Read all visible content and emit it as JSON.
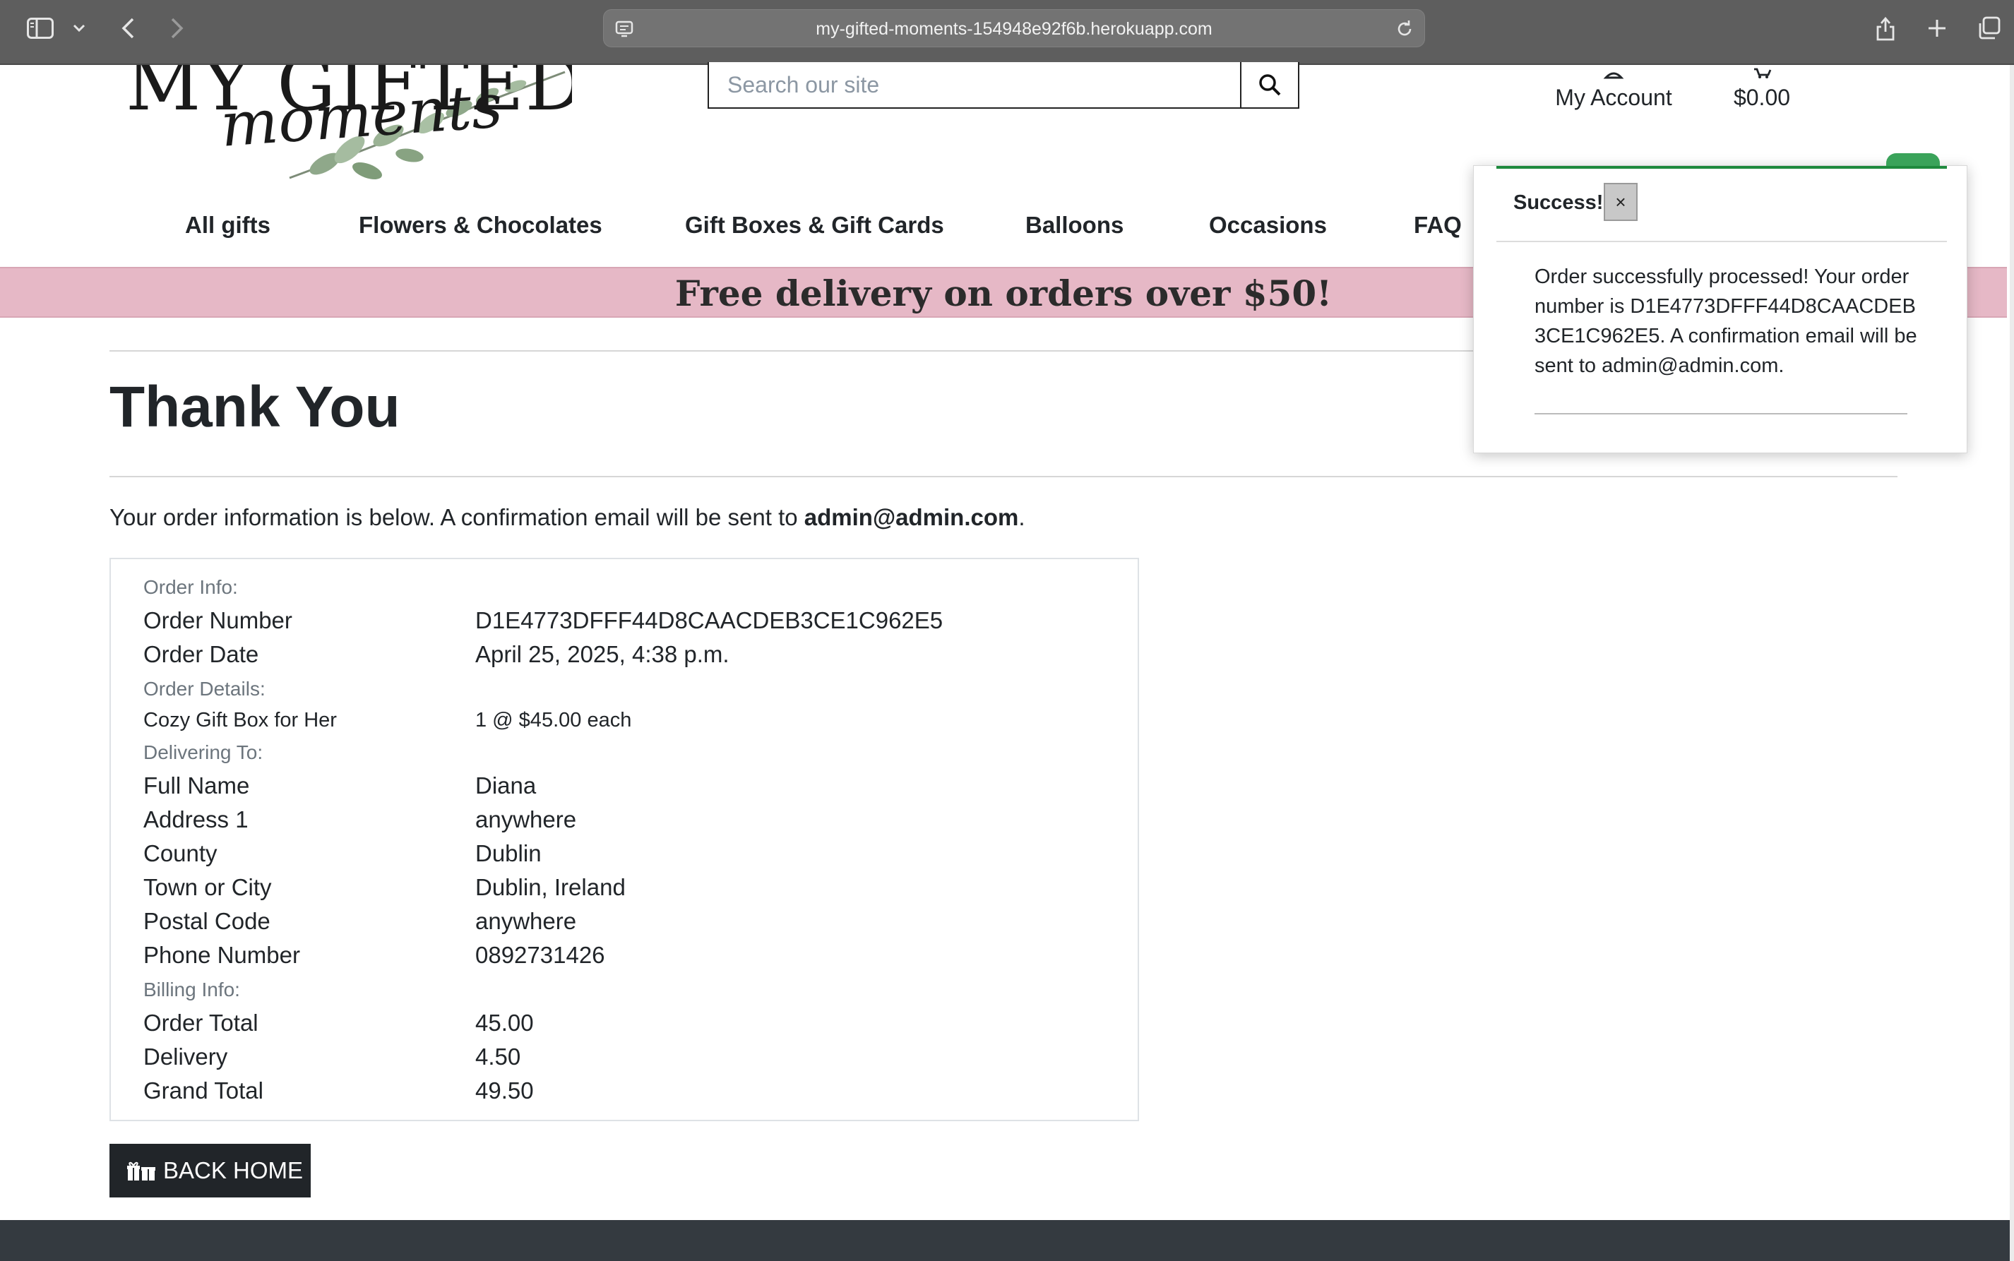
{
  "browser": {
    "url": "my-gifted-moments-154948e92f6b.herokuapp.com"
  },
  "header": {
    "logo_line1": "MY GIFTED",
    "logo_line2": "moments",
    "search_placeholder": "Search our site",
    "account_label": "My Account",
    "cart_total": "$0.00"
  },
  "nav": {
    "items": [
      "All gifts",
      "Flowers & Chocolates",
      "Gift Boxes & Gift Cards",
      "Balloons",
      "Occasions",
      "FAQ"
    ]
  },
  "banner": {
    "text": "Free delivery on orders over $50!"
  },
  "page": {
    "title": "Thank You",
    "intro_prefix": "Your order information is below. A confirmation email will be sent to ",
    "intro_email": "admin@admin.com",
    "intro_suffix": "."
  },
  "order": {
    "order_info_label": "Order Info:",
    "order_number_label": "Order Number",
    "order_number": "D1E4773DFFF44D8CAACDEB3CE1C962E5",
    "order_date_label": "Order Date",
    "order_date": "April 25, 2025, 4:38 p.m.",
    "order_details_label": "Order Details:",
    "item_name": "Cozy Gift Box for Her",
    "item_qty_price": "1 @ $45.00 each",
    "delivering_label": "Delivering To:",
    "full_name_label": "Full Name",
    "full_name": "Diana",
    "address1_label": "Address 1",
    "address1": "anywhere",
    "county_label": "County",
    "county": "Dublin",
    "town_label": "Town or City",
    "town": "Dublin, Ireland",
    "postal_label": "Postal Code",
    "postal": "anywhere",
    "phone_label": "Phone Number",
    "phone": "0892731426",
    "billing_label": "Billing Info:",
    "order_total_label": "Order Total",
    "order_total": "45.00",
    "delivery_label": "Delivery",
    "delivery": "4.50",
    "grand_total_label": "Grand Total",
    "grand_total": "49.50"
  },
  "actions": {
    "back_home": "BACK HOME"
  },
  "toast": {
    "header": "Success!",
    "close": "×",
    "message": "Order successfully processed! Your order number is D1E4773DFFF44D8CAACDEB3CE1C962E5. A confirmation email will be sent to admin@admin.com."
  },
  "colors": {
    "banner_bg": "#e6b8c6",
    "toast_accent": "#1f8a3e",
    "button_bg": "#212529",
    "footer_bg": "#343a40"
  }
}
